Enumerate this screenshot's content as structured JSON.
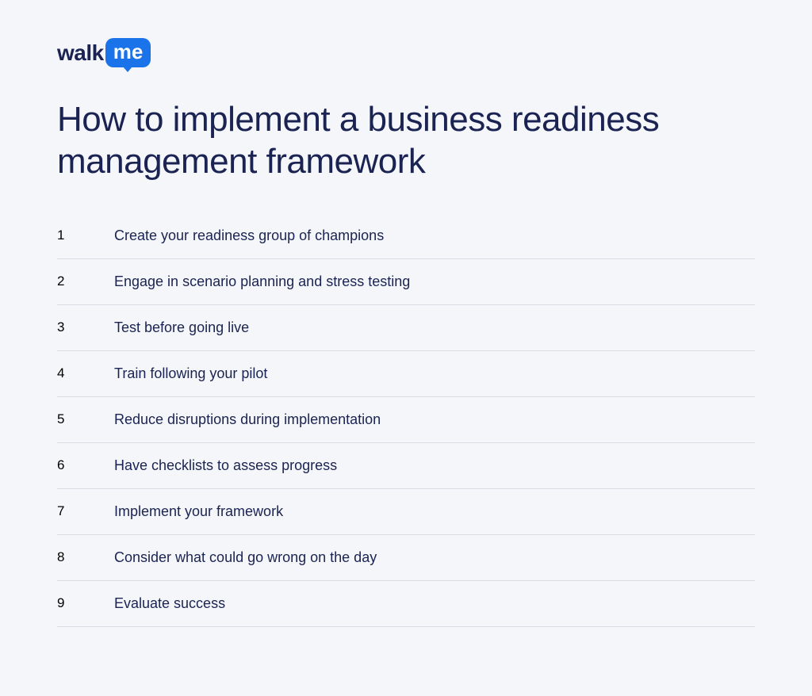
{
  "brand": {
    "part1": "walk",
    "part2": "me"
  },
  "title": "How to implement a business readiness management framework",
  "steps": [
    {
      "num": "1",
      "text": "Create your readiness group of champions"
    },
    {
      "num": "2",
      "text": "Engage in scenario planning and stress testing"
    },
    {
      "num": "3",
      "text": "Test before going live"
    },
    {
      "num": "4",
      "text": "Train following your pilot"
    },
    {
      "num": "5",
      "text": "Reduce disruptions during implementation"
    },
    {
      "num": "6",
      "text": "Have checklists to assess progress"
    },
    {
      "num": "7",
      "text": "Implement your framework"
    },
    {
      "num": "8",
      "text": "Consider what could go wrong on the day"
    },
    {
      "num": "9",
      "text": "Evaluate success"
    }
  ]
}
